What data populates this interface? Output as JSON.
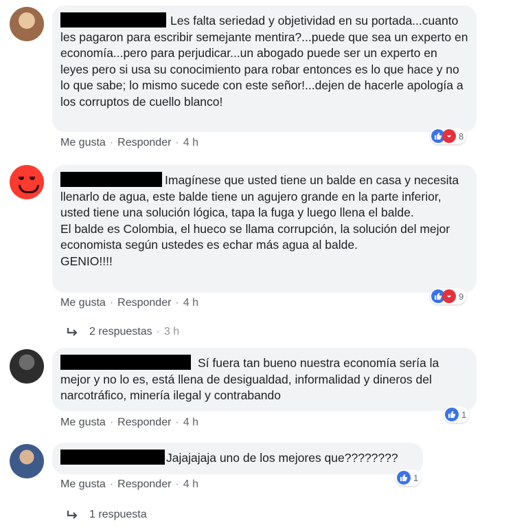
{
  "comments": [
    {
      "text": "Les falta seriedad y objetividad en su portada...cuanto les pagaron para escribir semejante mentira?...puede que sea un experto en economía...pero para perjudicar...un abogado puede ser un experto en leyes pero si usa su conocimiento para robar entonces es lo que hace y no lo que sabe; lo mismo sucede con este señor!...dejen de hacerle apología a los corruptos de cuello blanco!",
      "reaction_count": "8",
      "like": "Me gusta",
      "reply": "Responder",
      "time": "4 h"
    },
    {
      "text": "Imagínese que usted tiene un balde en casa y necesita llenarlo de agua, este balde tiene un agujero grande en la parte inferior, usted tiene una solución lógica, tapa la fuga y luego llena el balde.",
      "text2": "El balde es Colombia, el hueco se llama corrupción, la solución del mejor economista según ustedes es echar más agua al balde.",
      "text3": "GENIO!!!!",
      "reaction_count": "9",
      "like": "Me gusta",
      "reply": "Responder",
      "time": "4 h",
      "replies_label": "2 respuestas",
      "replies_time": "3 h"
    },
    {
      "text": "Sí fuera tan bueno nuestra economía sería la mejor y no lo es, está llena de desigualdad, informalidad y dineros del narcotráfico, minería ilegal y contrabando",
      "reaction_count": "1",
      "like": "Me gusta",
      "reply": "Responder",
      "time": "4 h"
    },
    {
      "text": "Jajajajaja uno de los mejores que????????",
      "reaction_count": "1",
      "like": "Me gusta",
      "reply": "Responder",
      "time": "4 h",
      "replies_label": "1 respuesta"
    }
  ],
  "separator": "·",
  "colors": {
    "bubble": "#f2f3f5",
    "like_blue": "#3b74e8",
    "haha_red": "#e4313c"
  },
  "icons": [
    "like-icon",
    "haha-icon",
    "reply-arrow-icon"
  ]
}
